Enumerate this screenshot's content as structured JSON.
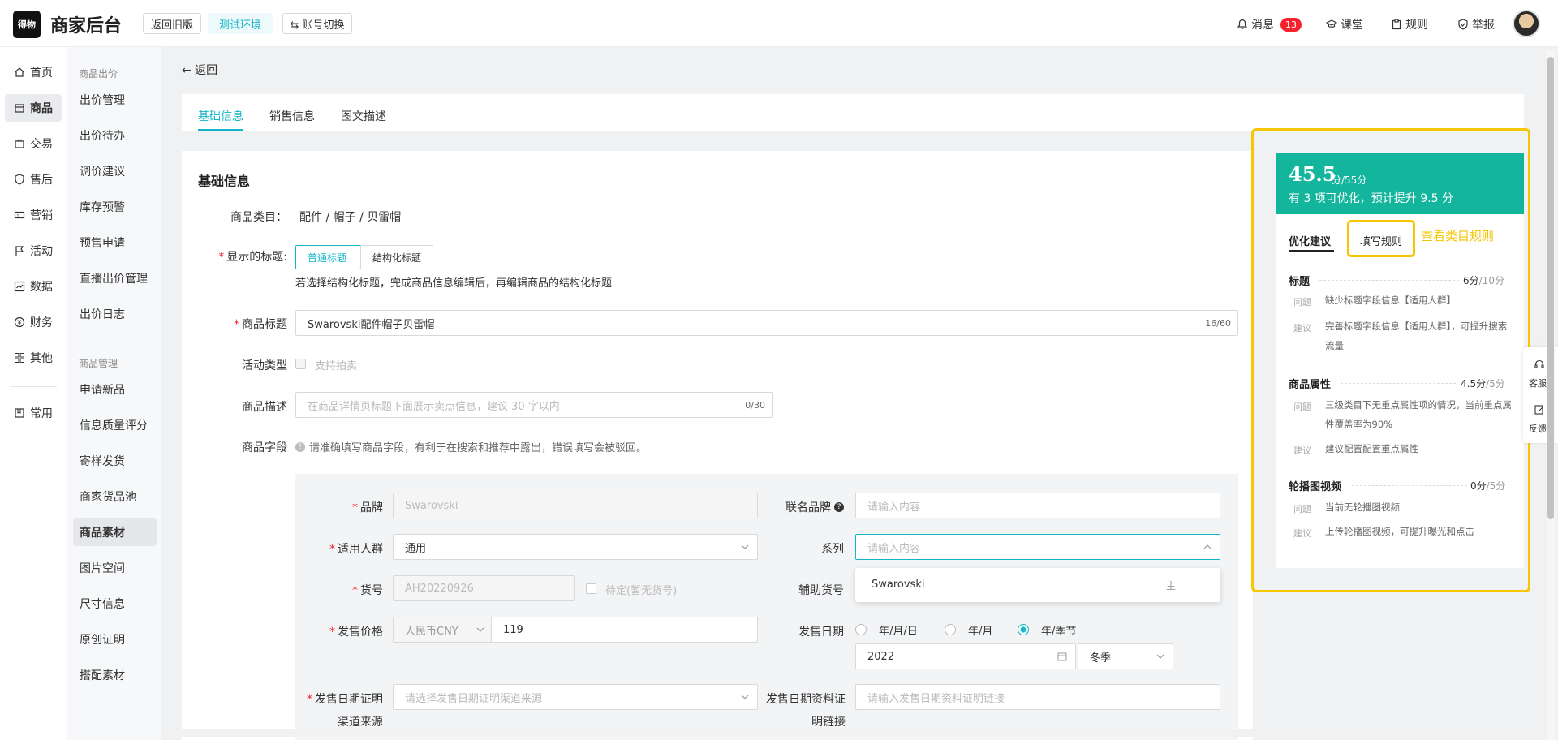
{
  "header": {
    "logo_text": "得物",
    "app_title": "商家后台",
    "back_old": "返回旧版",
    "env_tag": "测试环境",
    "switch_account": "⇆ 账号切换",
    "nav": {
      "messages": "消息",
      "messages_count": "13",
      "classroom": "课堂",
      "rules": "规则",
      "report": "举报"
    }
  },
  "sidebar": {
    "items": [
      {
        "label": "首页",
        "icon": "home-icon"
      },
      {
        "label": "商品",
        "icon": "shop-icon"
      },
      {
        "label": "交易",
        "icon": "bag-icon"
      },
      {
        "label": "售后",
        "icon": "shield-icon"
      },
      {
        "label": "营销",
        "icon": "ticket-icon"
      },
      {
        "label": "活动",
        "icon": "flag-icon"
      },
      {
        "label": "数据",
        "icon": "chart-icon"
      },
      {
        "label": "财务",
        "icon": "yen-icon"
      },
      {
        "label": "其他",
        "icon": "grid-icon"
      },
      {
        "label": "常用",
        "icon": "bookmark-icon"
      }
    ]
  },
  "subnav": {
    "group1": "商品出价",
    "group1_items": [
      "出价管理",
      "出价待办",
      "调价建议",
      "库存预警",
      "预售申请",
      "直播出价管理",
      "出价日志"
    ],
    "group2": "商品管理",
    "group2_items": [
      "申请新品",
      "信息质量评分",
      "寄样发货",
      "商家货品池",
      "商品素材",
      "图片空间",
      "尺寸信息",
      "原创证明",
      "搭配素材"
    ]
  },
  "main": {
    "back": "← 返回",
    "tabs": [
      "基础信息",
      "销售信息",
      "图文描述"
    ],
    "section_title": "基础信息",
    "category_label": "商品类目：",
    "category_value": "配件 / 帽子 / 贝雷帽",
    "display_title_label": "显示的标题:",
    "title_mode_normal": "普通标题",
    "title_mode_struct": "结构化标题",
    "title_mode_hint": "若选择结构化标题，完成商品信息编辑后，再编辑商品的结构化标题",
    "product_title_label": "商品标题",
    "product_title_value": "Swarovski配件帽子贝雷帽",
    "product_title_count": "16/60",
    "activity_type_label": "活动类型",
    "activity_type_option": "支持拍卖",
    "desc_label": "商品描述",
    "desc_placeholder": "在商品详情页标题下面展示卖点信息，建议 30 字以内",
    "desc_count": "0/30",
    "fields_label": "商品字段",
    "fields_hint": "请准确填写商品字段，有利于在搜索和推荐中露出，错误填写会被驳回。"
  },
  "form": {
    "brand_label": "品牌",
    "brand_value": "Swarovski",
    "cobrand_label": "联名品牌",
    "cobrand_placeholder": "请输入内容",
    "audience_label": "适用人群",
    "audience_value": "通用",
    "series_label": "系列",
    "series_placeholder": "请输入内容",
    "series_suggestion": "Swarovski",
    "series_suggestion_tag": "主",
    "sku_label": "货号",
    "sku_value": "AH20220926",
    "sku_pending": "待定(暂无货号)",
    "aux_sku_label": "辅助货号",
    "price_label": "发售价格",
    "currency": "人民币CNY",
    "price_value": "119",
    "release_date_label": "发售日期",
    "date_opt1": "年/月/日",
    "date_opt2": "年/月",
    "date_opt3": "年/季节",
    "year_value": "2022",
    "season_value": "冬季",
    "proof_label_line1": "发售日期证明",
    "proof_label_line2": "渠道来源",
    "proof_placeholder": "请选择发售日期证明渠道来源",
    "proof_link_label_line1": "发售日期资料证",
    "proof_link_label_line2": "明链接",
    "proof_link_placeholder": "请输入发售日期资料证明链接"
  },
  "panel": {
    "score": "45.5",
    "score_total": "分/55分",
    "score_sub": "有 3 项可优化，预计提升 9.5 分",
    "tab_suggest": "优化建议",
    "tab_rules": "填写规则",
    "view_category_rules": "查看类目规则",
    "issue_tag": "问题",
    "advice_tag": "建议",
    "sections": [
      {
        "title": "标题",
        "score": "6分",
        "total": "/10分",
        "issue": "缺少标题字段信息【适用人群】",
        "advice": "完善标题字段信息【适用人群】，可提升搜索流量"
      },
      {
        "title": "商品属性",
        "score": "4.5分",
        "total": "/5分",
        "issue": "三级类目下无重点属性项的情况，当前重点属性覆盖率为90%",
        "advice": "建议配置配置重点属性"
      },
      {
        "title": "轮播图视频",
        "score": "0分",
        "total": "/5分",
        "issue": "当前无轮播图视频",
        "advice": "上传轮播图视频，可提升曝光和点击"
      }
    ]
  },
  "float_widget": {
    "service": "客服",
    "feedback": "反馈"
  },
  "colors": {
    "accent": "#13b5c8",
    "score_bg": "#13b59c",
    "highlight": "#f7c600",
    "badge": "#f5222d"
  }
}
